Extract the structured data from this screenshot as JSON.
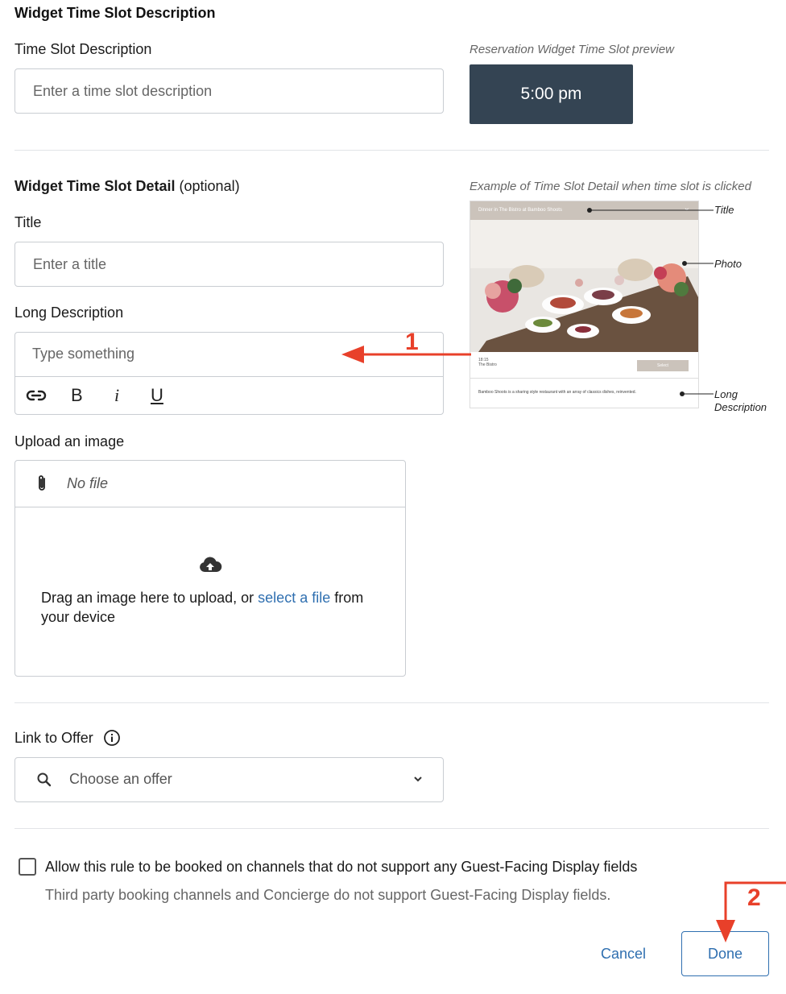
{
  "section1": {
    "heading": "Widget Time Slot Description",
    "field_label": "Time Slot Description",
    "placeholder": "Enter a time slot description",
    "preview_caption": "Reservation Widget Time Slot preview",
    "preview_button": "5:00 pm"
  },
  "section2": {
    "heading_bold": "Widget Time Slot Detail",
    "heading_suffix": " (optional)",
    "title_label": "Title",
    "title_placeholder": "Enter a title",
    "long_desc_label": "Long Description",
    "long_desc_placeholder": "Type something",
    "example_caption": "Example of Time Slot Detail when time slot is clicked",
    "example": {
      "header_text": "Dinner in The Bistro at Bamboo Shoots",
      "time": "18:15",
      "venue": "The Bistro",
      "select_label": "Select",
      "description": "Bamboo Shoots is a sharing style restaurant with an array of classics dishes, reinvented.",
      "tag_title": "Title",
      "tag_photo": "Photo",
      "tag_long_1": "Long",
      "tag_long_2": "Description"
    }
  },
  "toolbar": {
    "link_icon": "link-icon",
    "bold": "B",
    "italic": "i",
    "underline": "U"
  },
  "upload": {
    "label": "Upload an image",
    "file_status": "No file",
    "drag_text": "Drag an image here to upload, or ",
    "select_link": "select a file",
    "drag_text_end": " from your device"
  },
  "offer": {
    "label": "Link to Offer",
    "placeholder": "Choose an offer"
  },
  "checkbox": {
    "label": "Allow this rule to be booked on channels that do not support any Guest-Facing Display fields",
    "help": "Third party booking channels and Concierge do not support Guest-Facing Display fields."
  },
  "actions": {
    "cancel": "Cancel",
    "done": "Done"
  },
  "annotations": {
    "one": "1",
    "two": "2"
  },
  "colors": {
    "accent": "#2f6fb0",
    "preview_bg": "#344453",
    "annotation": "#e8402a"
  }
}
